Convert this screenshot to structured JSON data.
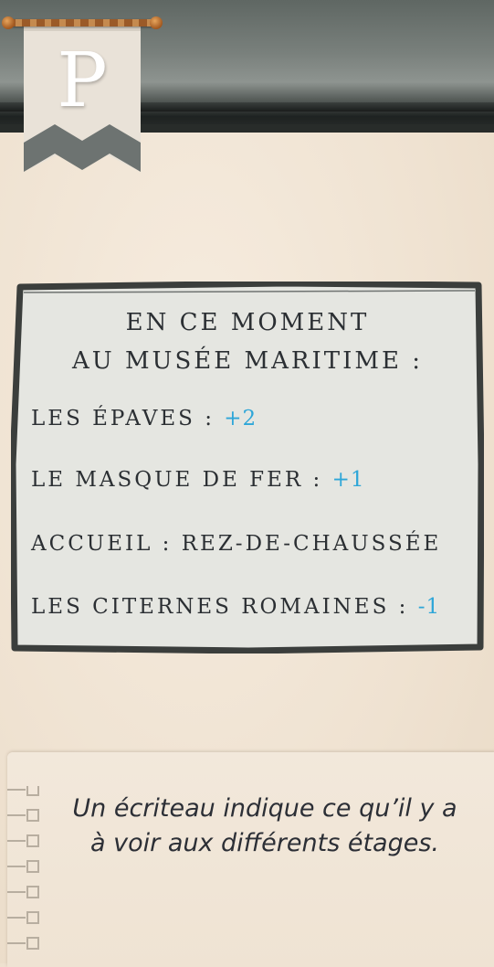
{
  "header": {
    "banner_letter": "P"
  },
  "sign": {
    "heading_line1": "En ce moment",
    "heading_line2": "au musée maritime :",
    "rows": [
      {
        "name": "Les épaves :",
        "floor": "+2"
      },
      {
        "name": "Le masque de fer :",
        "floor": "+1"
      },
      {
        "name": "Accueil : rez-de-chaussée",
        "floor": ""
      },
      {
        "name": "Les citernes romaines :",
        "floor": "-1"
      }
    ]
  },
  "note": {
    "line1": "Un écriteau indique ce qu’il y a",
    "line2": "à voir aux différents étages."
  },
  "colors": {
    "floor_accent": "#2ea6d8",
    "sign_board": "#e6e6e2",
    "sign_frame": "#3a3d3b",
    "paper": "#f2e8dc"
  },
  "icons": {
    "banner": "pennant-icon",
    "rod": "curtain-rod-icon",
    "notebook": "spiral-binding-icon"
  }
}
